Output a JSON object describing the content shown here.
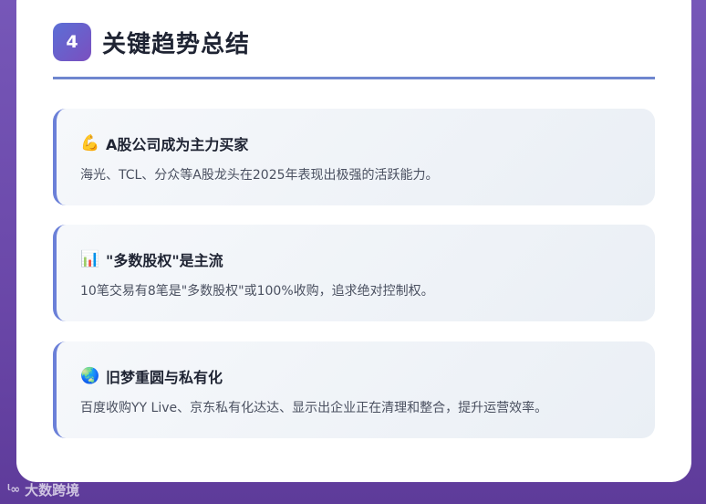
{
  "header": {
    "number": "4",
    "title": "关键趋势总结"
  },
  "items": [
    {
      "icon": "💪",
      "icon_name": "flexed-biceps-icon",
      "title": "A股公司成为主力买家",
      "description": "海光、TCL、分众等A股龙头在2025年表现出极强的活跃能力。"
    },
    {
      "icon": "📊",
      "icon_name": "bar-chart-icon",
      "title": "\"多数股权\"是主流",
      "description": "10笔交易有8笔是\"多数股权\"或100%收购，追求绝对控制权。"
    },
    {
      "icon": "🌏",
      "icon_name": "globe-icon",
      "title": "旧梦重圆与私有化",
      "description": "百度收购YY Live、京东私有化达达、显示出企业正在清理和整合，提升运营效率。"
    }
  ],
  "watermark": {
    "logo": "ᶩ∞",
    "text": "大数跨境"
  },
  "colors": {
    "accent": "#6b80d8",
    "badge_start": "#5b6fd6",
    "badge_end": "#7b4fbf",
    "background": "#6a47a8"
  }
}
